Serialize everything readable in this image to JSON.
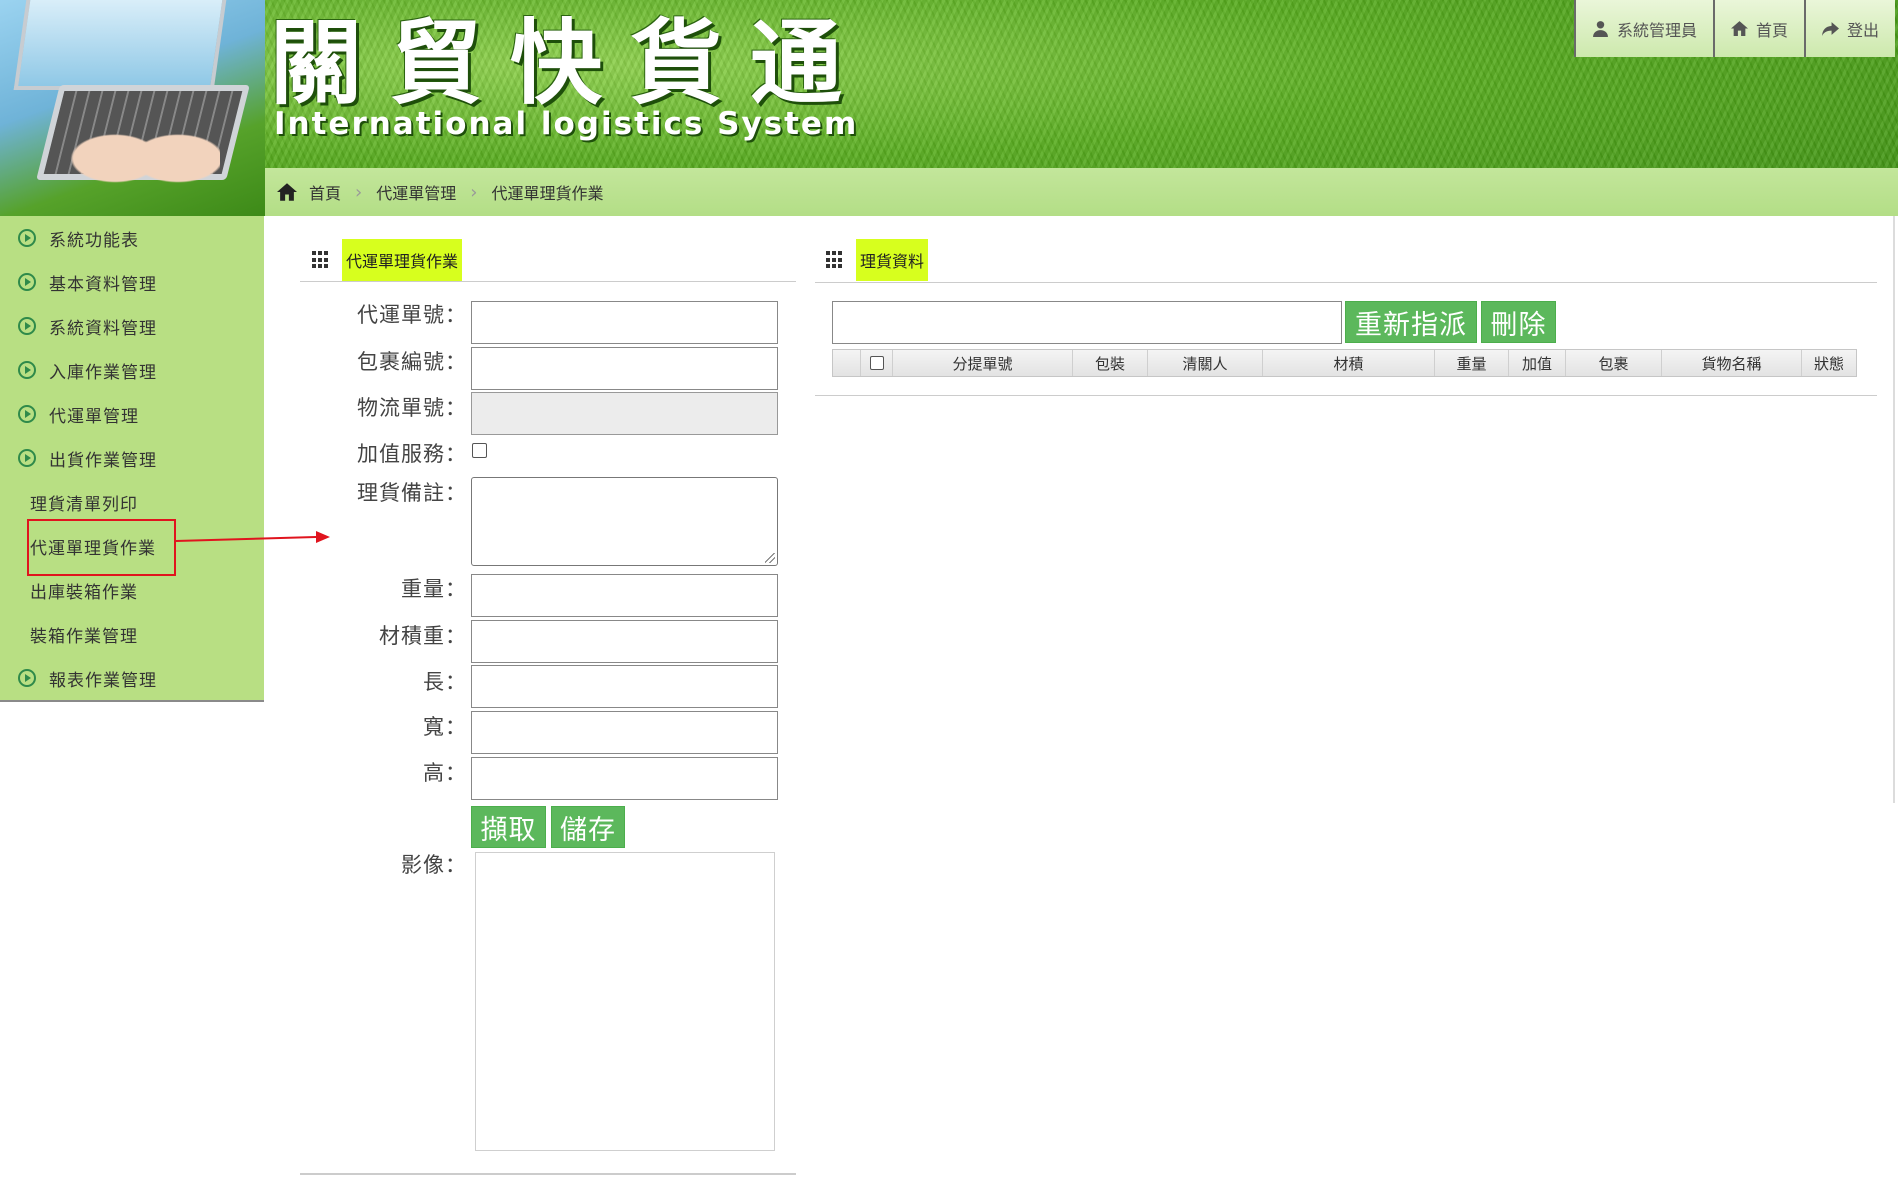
{
  "header": {
    "logo_cn": "關貿快貨通",
    "logo_en": "International logistics System",
    "nav": [
      {
        "label": "系統管理員",
        "icon": "user-icon"
      },
      {
        "label": "首頁",
        "icon": "home-icon"
      },
      {
        "label": "登出",
        "icon": "logout-arrow-icon"
      }
    ]
  },
  "breadcrumb": [
    "首頁",
    "代運單管理",
    "代運單理貨作業"
  ],
  "sidebar": {
    "items": [
      {
        "label": "系統功能表",
        "type": "group"
      },
      {
        "label": "基本資料管理",
        "type": "group"
      },
      {
        "label": "系統資料管理",
        "type": "group"
      },
      {
        "label": "入庫作業管理",
        "type": "group"
      },
      {
        "label": "代運單管理",
        "type": "group"
      },
      {
        "label": "出貨作業管理",
        "type": "group"
      },
      {
        "label": "理貨清單列印",
        "type": "sub"
      },
      {
        "label": "代運單理貨作業",
        "type": "sub",
        "highlighted": true
      },
      {
        "label": "出庫裝箱作業",
        "type": "sub"
      },
      {
        "label": "裝箱作業管理",
        "type": "sub"
      },
      {
        "label": "報表作業管理",
        "type": "group"
      }
    ]
  },
  "left_panel": {
    "title": "代運單理貨作業",
    "labels": {
      "order_no": "代運單號：",
      "package_no": "包裹編號：",
      "logistics_no": "物流單號：",
      "value_added": "加值服務：",
      "remark": "理貨備註：",
      "weight": "重量：",
      "volume_weight": "材積重：",
      "length": "長：",
      "width": "寬：",
      "height": "高：",
      "image": "影像："
    },
    "buttons": {
      "capture": "擷取",
      "save": "儲存"
    }
  },
  "right_panel": {
    "title": "理貨資料",
    "buttons": {
      "reassign": "重新指派",
      "delete": "刪除"
    },
    "columns": [
      "分提單號",
      "包裝",
      "清關人",
      "材積",
      "重量",
      "加值",
      "包裹",
      "貨物名稱",
      "狀態"
    ]
  },
  "colors": {
    "sidebar_bg": "#b8df83",
    "title_chip": "#d7ff1e",
    "button_green": "#5cb85c",
    "highlight_red": "#e0141e"
  }
}
